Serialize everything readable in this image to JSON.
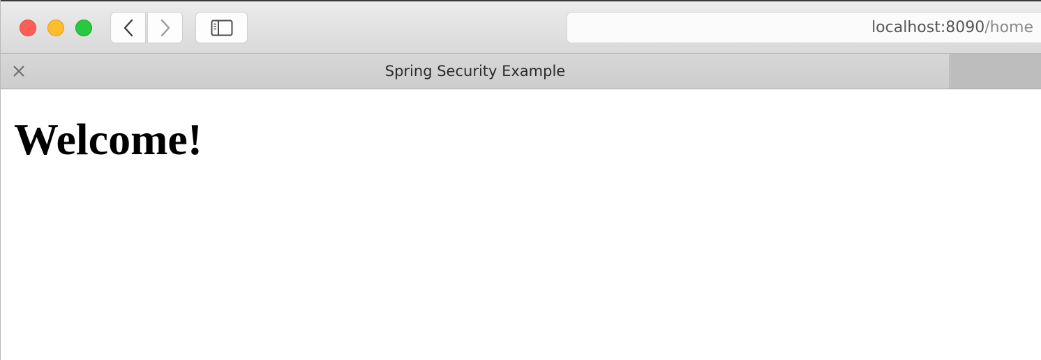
{
  "browser": {
    "url_host": "localhost:8090",
    "url_path": "/home",
    "tab_title": "Spring Security Example",
    "icons": {
      "close_window": "red-traffic-light",
      "minimize": "yellow-traffic-light",
      "maximize": "green-traffic-light",
      "back": "chevron-left-icon",
      "forward": "chevron-right-icon",
      "sidebar": "sidebar-icon",
      "tab_close": "close-icon"
    },
    "colors": {
      "close": "#fd5f57",
      "minimize": "#febc2e",
      "maximize": "#28c840"
    }
  },
  "page": {
    "heading": "Welcome!"
  }
}
